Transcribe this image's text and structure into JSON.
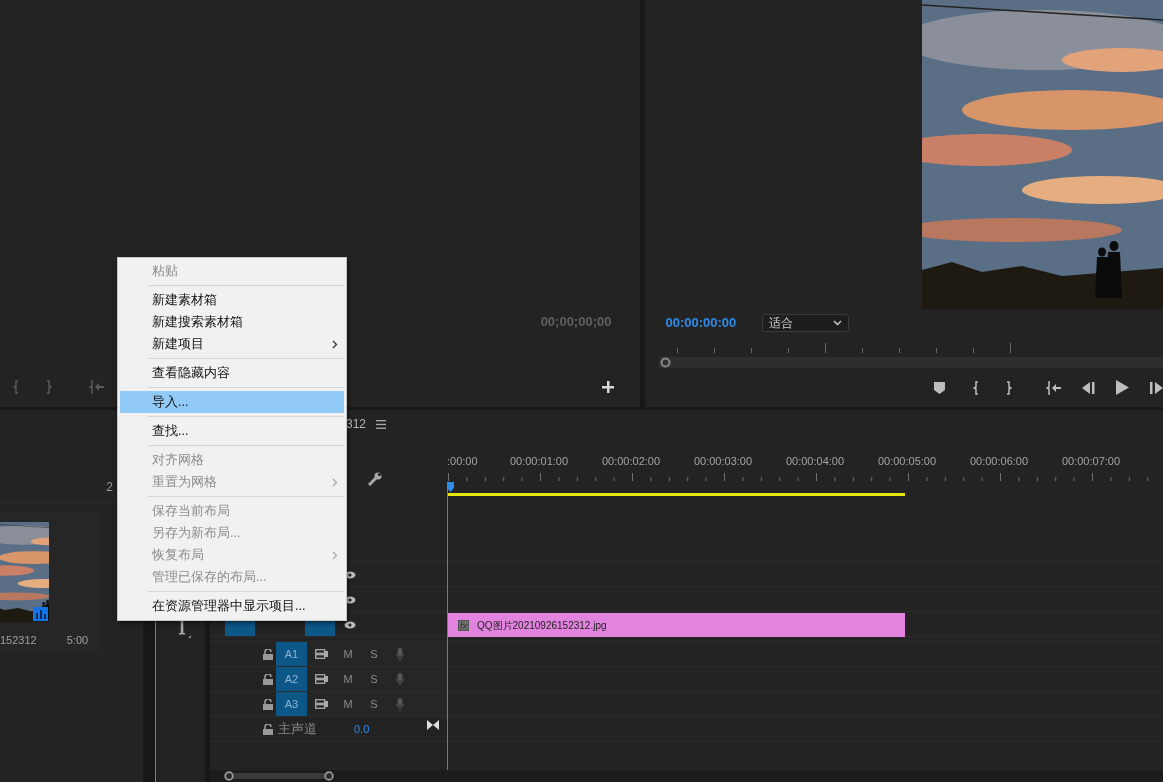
{
  "source_monitor": {
    "timecode": "00;00;00;00"
  },
  "program_monitor": {
    "timecode": "00:00:00:00",
    "zoom_dropdown": "适合"
  },
  "project_panel": {
    "item_count": "2",
    "clip": {
      "name": "152312",
      "duration": "5:00"
    }
  },
  "timeline": {
    "sequence_name": "312",
    "ruler_labels": [
      ":00:00",
      "00:00:01:00",
      "00:00:02:00",
      "00:00:03:00",
      "00:00:04:00",
      "00:00:05:00",
      "00:00:06:00",
      "00:00:07:00"
    ],
    "clip": {
      "badge": "fx",
      "name": "QQ图片20210926152312.jpg"
    },
    "audio_tracks": [
      {
        "label": "A1",
        "mute": "M",
        "solo": "S"
      },
      {
        "label": "A2",
        "mute": "M",
        "solo": "S"
      },
      {
        "label": "A3",
        "mute": "M",
        "solo": "S"
      }
    ],
    "master_track": {
      "label": "主声道",
      "volume": "0.0"
    }
  },
  "context_menu": {
    "items": [
      {
        "kind": "item",
        "label": "粘贴",
        "disabled": true,
        "selected": false,
        "submenu": false
      },
      {
        "kind": "separator"
      },
      {
        "kind": "item",
        "label": "新建素材箱",
        "disabled": false,
        "selected": false,
        "submenu": false
      },
      {
        "kind": "item",
        "label": "新建搜索素材箱",
        "disabled": false,
        "selected": false,
        "submenu": false
      },
      {
        "kind": "item",
        "label": "新建项目",
        "disabled": false,
        "selected": false,
        "submenu": true
      },
      {
        "kind": "separator"
      },
      {
        "kind": "item",
        "label": "查看隐藏内容",
        "disabled": false,
        "selected": false,
        "submenu": false
      },
      {
        "kind": "separator"
      },
      {
        "kind": "item",
        "label": "导入...",
        "disabled": false,
        "selected": true,
        "submenu": false
      },
      {
        "kind": "separator"
      },
      {
        "kind": "item",
        "label": "查找...",
        "disabled": false,
        "selected": false,
        "submenu": false
      },
      {
        "kind": "separator"
      },
      {
        "kind": "item",
        "label": "对齐网格",
        "disabled": true,
        "selected": false,
        "submenu": false
      },
      {
        "kind": "item",
        "label": "重置为网格",
        "disabled": true,
        "selected": false,
        "submenu": true
      },
      {
        "kind": "separator"
      },
      {
        "kind": "item",
        "label": "保存当前布局",
        "disabled": true,
        "selected": false,
        "submenu": false
      },
      {
        "kind": "item",
        "label": "另存为新布局...",
        "disabled": true,
        "selected": false,
        "submenu": false
      },
      {
        "kind": "item",
        "label": "恢复布局",
        "disabled": true,
        "selected": false,
        "submenu": true
      },
      {
        "kind": "item",
        "label": "管理已保存的布局...",
        "disabled": true,
        "selected": false,
        "submenu": false
      },
      {
        "kind": "separator"
      },
      {
        "kind": "item",
        "label": "在资源管理器中显示项目...",
        "disabled": false,
        "selected": false,
        "submenu": false
      }
    ]
  }
}
